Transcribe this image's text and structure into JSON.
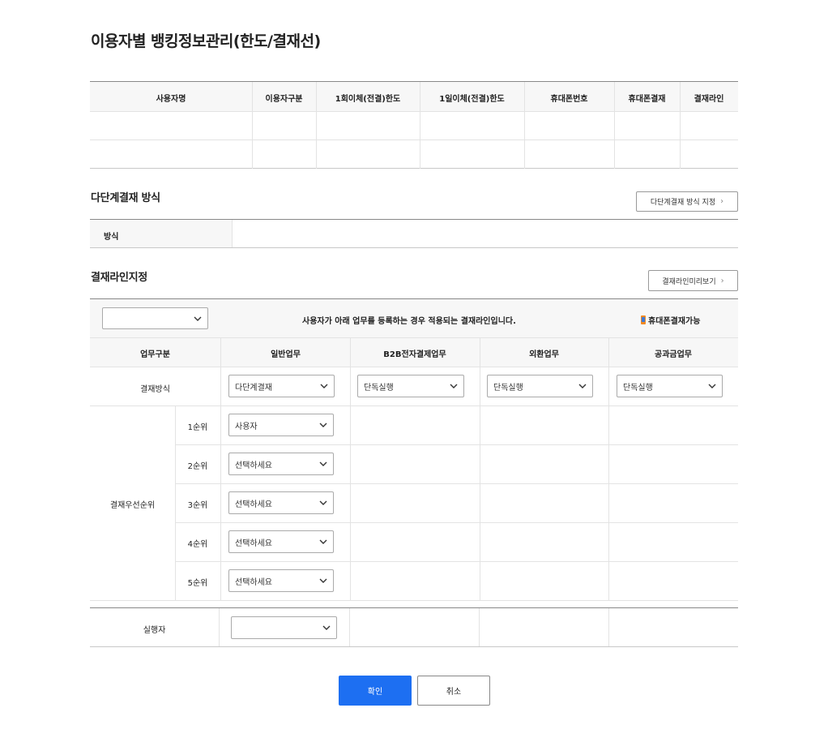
{
  "page": {
    "title": "이용자별 뱅킹정보관리(한도/결재선)"
  },
  "limits_table": {
    "headers": [
      "사용자명",
      "이용자구분",
      "1회이체(전결)한도",
      "1일이체(전결)한도",
      "휴대폰번호",
      "휴대폰결재",
      "결재라인"
    ],
    "rows": [
      [
        "",
        "",
        "",
        "",
        "",
        "",
        ""
      ],
      [
        "",
        "",
        "",
        "",
        "",
        "",
        ""
      ]
    ]
  },
  "multi_stage": {
    "title": "다단계결재 방식",
    "button": "다단계결재 방식 지정",
    "row_label": "방식",
    "row_value": ""
  },
  "approval_line": {
    "title": "결재라인지정",
    "preview_button": "결재라인미리보기",
    "top_select_value": "",
    "notice": "사용자가 아래 업무를 등록하는 경우 적용되는 결재라인입니다.",
    "mobile_label": "휴대폰결재가능",
    "columns": [
      "업무구분",
      "일반업무",
      "B2B전자결제업무",
      "외환업무",
      "공과금업무"
    ],
    "method_label": "결재방식",
    "methods": [
      "다단계결재",
      "단독실행",
      "단독실행",
      "단독실행"
    ],
    "priority_label": "결재우선순위",
    "priorities": [
      {
        "rank": "1순위",
        "value": "사용자"
      },
      {
        "rank": "2순위",
        "value": "선택하세요"
      },
      {
        "rank": "3순위",
        "value": "선택하세요"
      },
      {
        "rank": "4순위",
        "value": "선택하세요"
      },
      {
        "rank": "5순위",
        "value": "선택하세요"
      }
    ],
    "executor_label": "실행자",
    "executor_value": ""
  },
  "actions": {
    "confirm": "확인",
    "cancel": "취소"
  },
  "colors": {
    "primary": "#1d6ff2",
    "header_bg": "#f7f7f7",
    "line": "#e3e3e3",
    "mobile_icon": "#f08a24"
  },
  "icons": [
    "chevron-down-icon",
    "chevron-right-icon",
    "mobile-phone-icon"
  ]
}
